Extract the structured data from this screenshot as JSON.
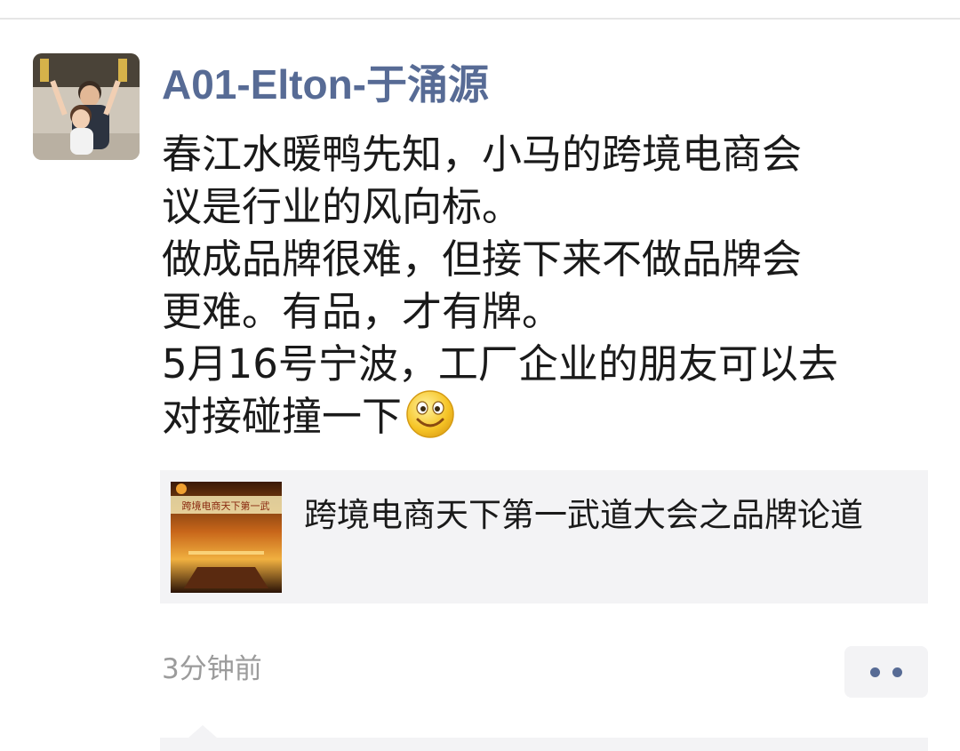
{
  "post": {
    "author": "A01-Elton-于涌源",
    "text_lines": [
      "春江水暖鸭先知，小马的跨境电商会",
      "议是行业的风向标。",
      "做成品牌很难，但接下来不做品牌会",
      "更难。有品，才有牌。",
      "5月16号宁波，工厂企业的朋友可以去",
      "对接碰撞一下"
    ],
    "emoji": "smile-emoji",
    "link": {
      "title": "跨境电商天下第一武道大会之品牌论道",
      "thumbnail_text": "跨境电商天下第一武"
    },
    "timestamp": "3分钟前",
    "more_icon": "more-dots-icon"
  },
  "colors": {
    "author": "#576b95",
    "text": "#1a1a1a",
    "meta": "#9b9b9b",
    "card_bg": "#f3f3f5"
  }
}
